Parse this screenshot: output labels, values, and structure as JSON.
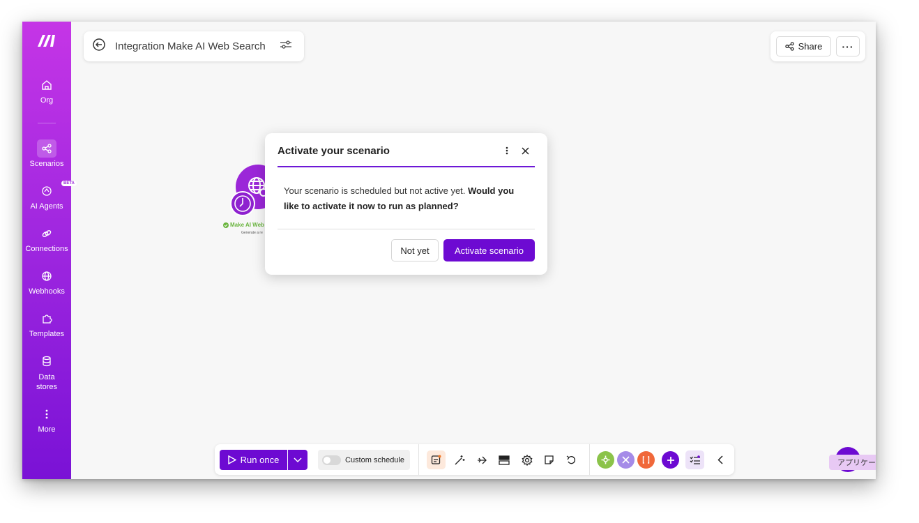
{
  "sidebar": {
    "items": [
      {
        "label": "Org",
        "icon": "home-icon"
      },
      {
        "label": "Scenarios",
        "icon": "share-nodes-icon"
      },
      {
        "label": "AI Agents",
        "icon": "ai-agent-icon",
        "badge": "BETA"
      },
      {
        "label": "Connections",
        "icon": "link-icon"
      },
      {
        "label": "Webhooks",
        "icon": "globe-icon"
      },
      {
        "label": "Templates",
        "icon": "puzzle-icon"
      },
      {
        "label": "Data stores",
        "icon": "database-icon"
      },
      {
        "label": "More",
        "icon": "kebab-icon"
      }
    ]
  },
  "header": {
    "title": "Integration Make AI Web Search"
  },
  "share": {
    "label": "Share",
    "more": "···"
  },
  "module": {
    "label": "Make AI Web",
    "sublabel": "Generate a re"
  },
  "dialog": {
    "title": "Activate your scenario",
    "body_plain": "Your scenario is scheduled but not active yet. ",
    "body_bold": "Would you like to activate it now to run as planned?",
    "cancel_label": "Not yet",
    "confirm_label": "Activate scenario"
  },
  "toolbar": {
    "run_label": "Run once",
    "schedule_label": "Custom schedule"
  },
  "assistant": {
    "tooltip": "アプリケー"
  },
  "colors": {
    "brand": "#6d0ad2",
    "sidebar_top": "#c535e6",
    "sidebar_bottom": "#7a12d6"
  }
}
